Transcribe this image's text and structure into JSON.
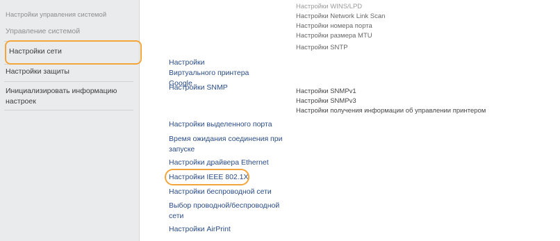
{
  "sidebar": {
    "header": "Настройки управления системой",
    "items": [
      {
        "label": "Управление системой"
      },
      {
        "label": "Настройки сети"
      },
      {
        "label": "Настройки защиты"
      },
      {
        "label": "Инициализировать информацию настроек"
      }
    ]
  },
  "main": {
    "top_notes": [
      "Настройки WINS/LPD",
      "Настройки Network Link Scan",
      "Настройки номера порта",
      "Настройки размера MTU",
      "Настройки SNTP"
    ],
    "links": [
      {
        "label": "Настройки Виртуального принтера Google"
      },
      {
        "label": "Настройки SNMP"
      },
      {
        "label": "Настройки выделенного порта"
      },
      {
        "label": "Время ожидания соединения при запуске"
      },
      {
        "label": "Настройки драйвера Ethernet"
      },
      {
        "label": "Настройки IEEE 802.1X"
      },
      {
        "label": "Настройки беспроводной сети"
      },
      {
        "label": "Выбор проводной/беспроводной сети"
      },
      {
        "label": "Настройки AirPrint"
      }
    ],
    "snmp_subitems": [
      "Настройки SNMPv1",
      "Настройки SNMPv3",
      "Настройки получения информации об управлении принтером"
    ]
  },
  "colors": {
    "highlight": "#f4a53a",
    "link": "#2a4c86",
    "sidebar_bg": "#e9ebec"
  }
}
